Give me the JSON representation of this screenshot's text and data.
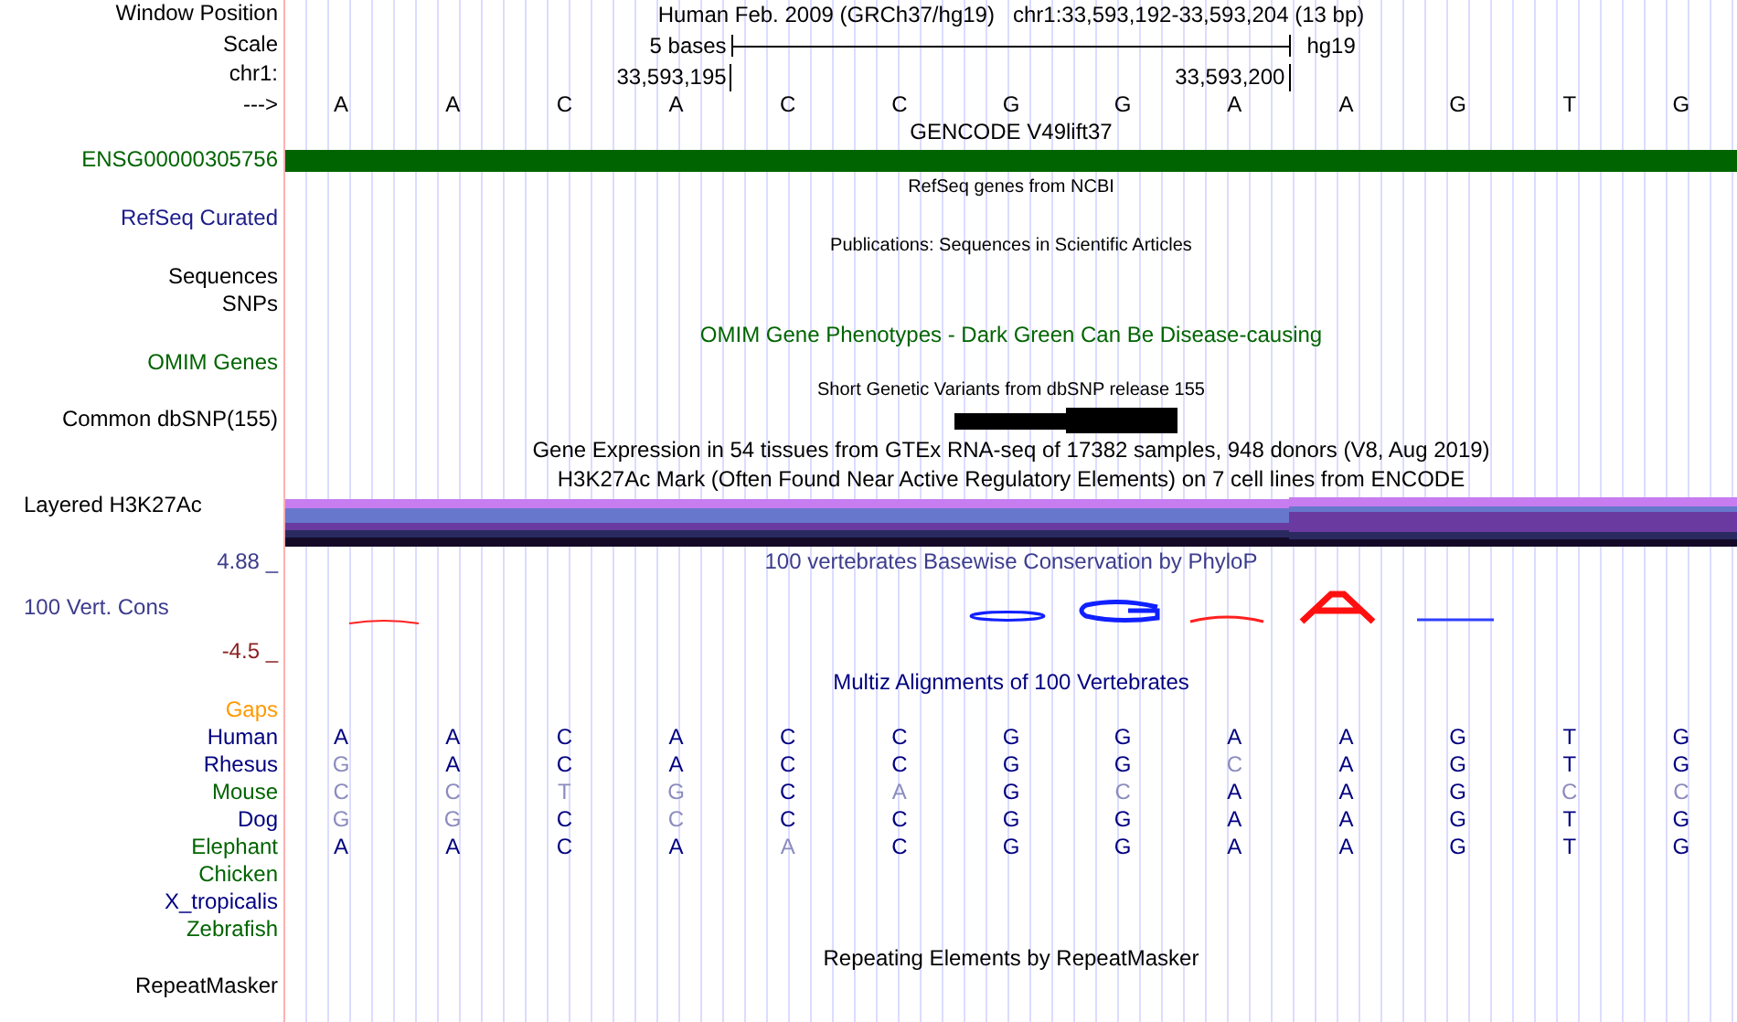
{
  "header": {
    "label": "Window Position",
    "assembly_title": "Human Feb. 2009 (GRCh37/hg19)",
    "position": "chr1:33,593,192-33,593,204 (13 bp)"
  },
  "scale": {
    "label": "Scale",
    "span": "5 bases",
    "assembly": "hg19"
  },
  "coordinates": {
    "label": "chr1:",
    "start": "33,593,195",
    "end": "33,593,200"
  },
  "sequence": {
    "label": "--->",
    "bases": [
      "A",
      "A",
      "C",
      "A",
      "C",
      "C",
      "G",
      "G",
      "A",
      "A",
      "G",
      "T",
      "G"
    ]
  },
  "tracks": [
    {
      "kind": "gene",
      "title": "GENCODE V49lift37",
      "color": "#000000",
      "labels": [
        {
          "text": "ENSG00000305756",
          "color": "#006400"
        }
      ]
    },
    {
      "kind": "pack",
      "title": "RefSeq genes from NCBI",
      "color": "#000000",
      "labels": [
        {
          "text": "RefSeq Curated",
          "color": "#1c1c8c"
        }
      ]
    },
    {
      "kind": "pack",
      "title": "Publications: Sequences in Scientific Articles",
      "color": "#000000",
      "labels": [
        {
          "text": "Sequences",
          "color": "#000000"
        },
        {
          "text": "SNPs",
          "color": "#000000"
        }
      ]
    },
    {
      "kind": "full",
      "title": "OMIM Gene Phenotypes - Dark Green Can Be Disease-causing",
      "color": "#006400",
      "labels": [
        {
          "text": "OMIM Genes",
          "color": "#006400"
        }
      ]
    },
    {
      "kind": "snp",
      "title": "Short Genetic Variants from dbSNP release 155",
      "color": "#000000",
      "labels": [
        {
          "text": "Common dbSNP(155)",
          "color": "#000000"
        }
      ]
    },
    {
      "kind": "text",
      "title": "Gene Expression in 54 tissues from GTEx RNA-seq of 17382 samples, 948 donors (V8, Aug 2019)",
      "color": "#000000"
    },
    {
      "kind": "layered",
      "title": "H3K27Ac Mark (Often Found Near Active Regulatory Elements) on 7 cell lines from ENCODE",
      "color": "#000000",
      "labels": [
        {
          "text": "Layered H3K27Ac",
          "color": "#000000"
        }
      ]
    },
    {
      "kind": "wiggle",
      "title": "100 vertebrates Basewise Conservation by PhyloP",
      "color": "#3c3c8c",
      "labels": [
        {
          "text": "4.88 _",
          "color": "#3c3c8c"
        },
        {
          "text": "100 Vert. Cons",
          "color": "#3c3c8c"
        },
        {
          "text": "-4.5 _",
          "color": "#8b2323"
        }
      ]
    },
    {
      "kind": "multiz",
      "title": "Multiz Alignments of 100 Vertebrates",
      "color": "#000080",
      "species": [
        {
          "name": "Gaps",
          "color": "#ff9900"
        },
        {
          "name": "Human",
          "color": "#000080",
          "bases": [
            {
              "base": "A",
              "differs": false
            },
            {
              "base": "A",
              "differs": false
            },
            {
              "base": "C",
              "differs": false
            },
            {
              "base": "A",
              "differs": false
            },
            {
              "base": "C",
              "differs": false
            },
            {
              "base": "C",
              "differs": false
            },
            {
              "base": "G",
              "differs": false
            },
            {
              "base": "G",
              "differs": false
            },
            {
              "base": "A",
              "differs": false
            },
            {
              "base": "A",
              "differs": false
            },
            {
              "base": "G",
              "differs": false
            },
            {
              "base": "T",
              "differs": false
            },
            {
              "base": "G",
              "differs": false
            }
          ]
        },
        {
          "name": "Rhesus",
          "color": "#000080",
          "bases": [
            {
              "base": "G",
              "differs": true
            },
            {
              "base": "A",
              "differs": false
            },
            {
              "base": "C",
              "differs": false
            },
            {
              "base": "A",
              "differs": false
            },
            {
              "base": "C",
              "differs": false
            },
            {
              "base": "C",
              "differs": false
            },
            {
              "base": "G",
              "differs": false
            },
            {
              "base": "G",
              "differs": false
            },
            {
              "base": "C",
              "differs": true
            },
            {
              "base": "A",
              "differs": false
            },
            {
              "base": "G",
              "differs": false
            },
            {
              "base": "T",
              "differs": false
            },
            {
              "base": "G",
              "differs": false
            }
          ]
        },
        {
          "name": "Mouse",
          "color": "#006400",
          "bases": [
            {
              "base": "C",
              "differs": true
            },
            {
              "base": "C",
              "differs": true
            },
            {
              "base": "T",
              "differs": true
            },
            {
              "base": "G",
              "differs": true
            },
            {
              "base": "C",
              "differs": false
            },
            {
              "base": "A",
              "differs": true
            },
            {
              "base": "G",
              "differs": false
            },
            {
              "base": "C",
              "differs": true
            },
            {
              "base": "A",
              "differs": false
            },
            {
              "base": "A",
              "differs": false
            },
            {
              "base": "G",
              "differs": false
            },
            {
              "base": "C",
              "differs": true
            },
            {
              "base": "C",
              "differs": true
            }
          ]
        },
        {
          "name": "Dog",
          "color": "#000080",
          "bases": [
            {
              "base": "G",
              "differs": true
            },
            {
              "base": "G",
              "differs": true
            },
            {
              "base": "C",
              "differs": false
            },
            {
              "base": "C",
              "differs": true
            },
            {
              "base": "C",
              "differs": false
            },
            {
              "base": "C",
              "differs": false
            },
            {
              "base": "G",
              "differs": false
            },
            {
              "base": "G",
              "differs": false
            },
            {
              "base": "A",
              "differs": false
            },
            {
              "base": "A",
              "differs": false
            },
            {
              "base": "G",
              "differs": false
            },
            {
              "base": "T",
              "differs": false
            },
            {
              "base": "G",
              "differs": false
            }
          ]
        },
        {
          "name": "Elephant",
          "color": "#006400",
          "bases": [
            {
              "base": "A",
              "differs": false
            },
            {
              "base": "A",
              "differs": false
            },
            {
              "base": "C",
              "differs": false
            },
            {
              "base": "A",
              "differs": false
            },
            {
              "base": "A",
              "differs": true
            },
            {
              "base": "C",
              "differs": false
            },
            {
              "base": "G",
              "differs": false
            },
            {
              "base": "G",
              "differs": false
            },
            {
              "base": "A",
              "differs": false
            },
            {
              "base": "A",
              "differs": false
            },
            {
              "base": "G",
              "differs": false
            },
            {
              "base": "T",
              "differs": false
            },
            {
              "base": "G",
              "differs": false
            }
          ]
        },
        {
          "name": "Chicken",
          "color": "#006400"
        },
        {
          "name": "X_tropicalis",
          "color": "#000080"
        },
        {
          "name": "Zebrafish",
          "color": "#006400"
        }
      ]
    },
    {
      "kind": "full",
      "title": "Repeating Elements by RepeatMasker",
      "color": "#000000",
      "labels": [
        {
          "text": "RepeatMasker",
          "color": "#000000"
        }
      ]
    }
  ]
}
